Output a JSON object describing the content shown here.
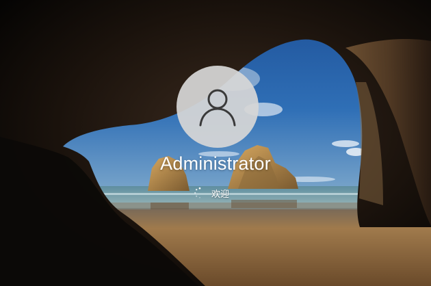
{
  "lock_screen": {
    "user": {
      "name": "Administrator",
      "avatar_icon": "user-icon"
    },
    "status": {
      "text": "欢迎",
      "indicator_icon": "loading-spinner-icon"
    }
  },
  "colors": {
    "sky": "#2a64a8",
    "sea": "#6a8f9a",
    "sand": "#9a7448",
    "cave": "#140f0b",
    "avatar_bg": "#d6d6d6",
    "avatar_fg": "#3a3a3a",
    "text": "#ffffff"
  }
}
